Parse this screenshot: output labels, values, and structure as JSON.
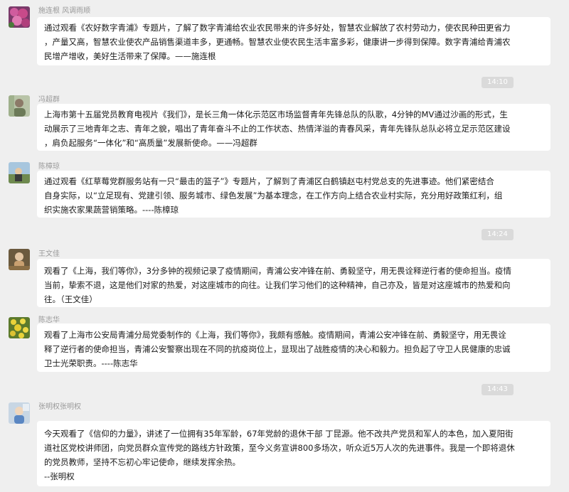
{
  "messages": [
    {
      "sender": "施连根 风调雨顺",
      "lines": [
        "通过观看《农好数字青浦》专题片，了解了数字青浦给农业农民带来的许多好处，智慧农业解放了农村劳动力，使农民种田更省力",
        "，产量又高，智慧农业使农产品销售渠道丰多，更通畅。智慧农业使农民生活丰富多彩，健康讲一步得到保障。数字青浦给青浦农",
        "民增产增收，美好生活带来了保障。——施连根"
      ]
    },
    {
      "sender": "冯超群",
      "lines": [
        "上海市第十五届党员教育电视片《我们》，是长三角一体化示范区市场监督青年先锋总队的队歌，4分钟的MV通过沙画的形式，生",
        "动展示了三地青年之志、青年之貌，唱出了青年奋斗不止的工作状态、热情洋溢的青春风采，青年先锋队总队必将立足示范区建设",
        "，肩负起服务“一体化”和“高质量”发展新使命。——冯超群"
      ]
    },
    {
      "sender": "陈樟琼",
      "lines": [
        "通过观看《红草莓党群服务站有一只“最击的篮子”》专题片，了解到了青浦区白鹤镇赵屯村党总支的先进事迹。他们紧密结合",
        "自身实际，以“立足现有、党建引领、服务城市、绿色发展”为基本理念，在工作方向上结合农业村实际，充分用好政策红利，组",
        "织实施农家果蔬营销策略。----陈樟琼"
      ]
    },
    {
      "sender": "王文佳",
      "lines": [
        "观看了《上海，我们等你》，3分多钟的视频记录了疫情期间，青浦公安冲锋在前、勇毅坚守，用无畏诠释逆行者的使命担当。疫情",
        "当前，挚索不退，这是他们对家的热爱，对这座城市的向往。让我们学习他们的这种精神，自己亦及，皆是对这座城市的热爱和向",
        "往。（王文佳）"
      ]
    },
    {
      "sender": "陈志华",
      "lines": [
        "观看了上海市公安局青浦分局党委制作的《上海，我们等你》，我颇有感触。疫情期间，青浦公安冲锋在前、勇毅坚守，用无畏诠",
        "释了逆行者的使命担当，青浦公安警察出现在不同的抗疫岗位上，显现出了战胜疫情的决心和毅力。担负起了守卫人民健康的忠诚",
        "卫士光荣职责。----陈志华"
      ]
    },
    {
      "sender": "张明权张明权",
      "lines": [
        "今天观看了《信仰的力量》，讲述了一位拥有35年军龄，67年党龄的退休干部 丁昆源。他不改共产党员和军人的本色，加入夏阳街",
        "道社区党校讲师团，向党员群众宣传党的路线方针政策，至今义务宣讲800多场次，听众近5万人次的先进事件。我是一个即将退休",
        "的党员教师，坚持不忘初心牢记使命，继续发挥余热。",
        "--张明权"
      ]
    }
  ],
  "timestamps": [
    "14:10",
    "14:24",
    "14:43"
  ]
}
